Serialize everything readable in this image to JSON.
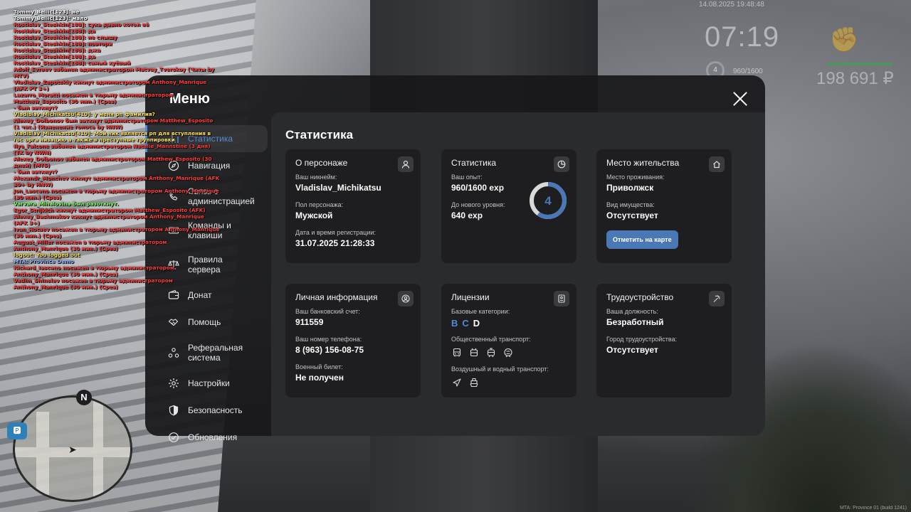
{
  "chat": [
    {
      "text": "Tommy_Bellic[123]: не",
      "color": "#ffffff"
    },
    {
      "text": "Tommy_Bellic[123]: мало",
      "color": "#ffffff"
    },
    {
      "text": "Rostislav_Steshkin[188]: сука давно хотел её",
      "color": "#ff3a3a"
    },
    {
      "text": "Rostislav_Steshkin[188]: да",
      "color": "#ff3a3a"
    },
    {
      "text": "Rostislav_Steshkin[188]: не слышу",
      "color": "#ff3a3a"
    },
    {
      "text": "Rostislav_Steshkin[188]: повтори",
      "color": "#ff3a3a"
    },
    {
      "text": "Rostislav_Steshkin[188]: джа",
      "color": "#ff3a3a"
    },
    {
      "text": "Rostislav_Steshkin[188]: да",
      "color": "#ff3a3a"
    },
    {
      "text": "Rostislav_Steshkin[188]: самый хуёвый",
      "color": "#ff3a3a"
    },
    {
      "text": "Adolf_Evreev забанен администратором Matvey_Tverskoy (Читы by MTV)",
      "color": "#ff3a3a"
    },
    {
      "text": "Vladislav_Zapotskiy кикнут администратором Anthony_Manrique (AFK PT 3+)",
      "color": "#ff3a3a"
    },
    {
      "text": "Lazarro_Moratti посажен в тюрьму администратором Matthew_Esposito (30 мин.) (Срез)",
      "color": "#ff3a3a"
    },
    {
      "text": "- был заткнут?",
      "color": "#ff3a3a"
    },
    {
      "text": "Vladislav_Michikatsu[410]: у меня рп фамилия?",
      "color": "#ffe14a"
    },
    {
      "text": "Alexey_Dolbonov был заткнут администратором Matthew_Esposito (1 час.) (Изменение голоса by HNW)",
      "color": "#ff3a3a"
    },
    {
      "text": "Vladislav_Michikatsu[410]: Мой ник является рп для вступления в гос орга низацию а также в преступные группировки",
      "color": "#ffe14a"
    },
    {
      "text": "Ilya_Falcone забанен администратором Natalie_Mannstine (3 дня) (TK by NWN)",
      "color": "#ff3a3a"
    },
    {
      "text": "Alexey_Dolbonov забанен администратором Matthew_Esposito (30 дней) (MTS)",
      "color": "#ff3a3a"
    },
    {
      "text": "- был заткнут?",
      "color": "#ff3a3a"
    },
    {
      "text": "Alexandr_Munchev кикнут администратором Anthony_Manrique (AFK 30+ by HNW)",
      "color": "#ff3a3a"
    },
    {
      "text": "Jon_Lascano посажен в тюрьму администратором Anthony_Manrique (30 мин.) (Срез)",
      "color": "#ff3a3a"
    },
    {
      "text": "Varvara_Mihalovina был разоткнут.",
      "color": "#7dff5a"
    },
    {
      "text": "Egor_Strijkich кикнут администратором Matthew_Esposito (AFK)",
      "color": "#ff3a3a"
    },
    {
      "text": "Alexey_Bashmakov кикнут администратором Anthony_Manrique (AFK 3+)",
      "color": "#ff3a3a"
    },
    {
      "text": "Ivan_Hotaev посажен в тюрьму администратором Anthony_Manrique (30 мин.) (Срез)",
      "color": "#ff3a3a"
    },
    {
      "text": "August_Miller посажен в тюрьму администратором Anthony_Manrique (30 мин.) (Срез)",
      "color": "#ff3a3a"
    },
    {
      "text": "logout: You logged out",
      "color": "#ffe14a"
    },
    {
      "text": "MTA: Province Demo",
      "color": "#8fb8ff"
    },
    {
      "text": "Richard_Iascano посажен в тюрьму администратором Anthony_Manrique (30 мин.) (Срез)",
      "color": "#ff3a3a"
    },
    {
      "text": "Vadim_Shinelev посажен в тюрьму администратором Anthony_Manrique (30 мин.) (Срез)",
      "color": "#ff3a3a"
    }
  ],
  "hud": {
    "date": "14.08.2025 19:48:48",
    "time": "07:19",
    "level": "4",
    "exp": "960/1600",
    "money": "198 691 ₽"
  },
  "minimap": {
    "north": "N"
  },
  "watermark": "MTA: Province 01 (build 1241) ",
  "menu": {
    "title": "Меню",
    "nav": [
      {
        "label": "Статистика",
        "icon": "chart-icon",
        "active": true
      },
      {
        "label": "Навигация",
        "icon": "compass-icon"
      },
      {
        "label": "Связь с администрацией",
        "icon": "phone-icon"
      },
      {
        "label": "Команды и клавиши",
        "icon": "keyboard-icon"
      },
      {
        "label": "Правила сервера",
        "icon": "scales-icon"
      },
      {
        "label": "Донат",
        "icon": "wallet-icon"
      },
      {
        "label": "Помощь",
        "icon": "handshake-icon"
      },
      {
        "label": "Реферальная система",
        "icon": "referral-icon"
      },
      {
        "label": "Настройки",
        "icon": "gear-icon"
      },
      {
        "label": "Безопасность",
        "icon": "shield-icon"
      },
      {
        "label": "Обновления",
        "icon": "update-icon"
      }
    ]
  },
  "stats": {
    "title": "Статистика",
    "character": {
      "title": "О персонаже",
      "nickname_label": "Ваш никнейм:",
      "nickname": "Vladislav_Michikatsu",
      "gender_label": "Пол персонажа:",
      "gender": "Мужской",
      "reg_label": "Дата и время регистрации:",
      "reg": "31.07.2025 21:28:33"
    },
    "statistics": {
      "title": "Статистика",
      "exp_label": "Ваш опыт:",
      "exp": "960/1600 exp",
      "next_label": "До нового уровня:",
      "next": "640 exp",
      "level": "4",
      "progress": 0.6
    },
    "residence": {
      "title": "Место жительства",
      "place_label": "Место проживания:",
      "place": "Приволжск",
      "property_label": "Вид имущества:",
      "property": "Отсутствует",
      "button": "Отметить на карте"
    },
    "personal": {
      "title": "Личная информация",
      "bank_label": "Ваш банковский счет:",
      "bank": "911559",
      "phone_label": "Ваш номер телефона:",
      "phone": "8 (963) 156-08-75",
      "military_label": "Военный билет:",
      "military": "Не получен"
    },
    "licenses": {
      "title": "Лицензии",
      "basic_label": "Базовые категории:",
      "categories": [
        {
          "letter": "B",
          "color": "#4f8bd6"
        },
        {
          "letter": "C",
          "color": "#4f8bd6"
        },
        {
          "letter": "D",
          "color": "#ffffff"
        }
      ],
      "public_label": "Общественный транспорт:",
      "air_label": "Воздушный и водный транспорт:"
    },
    "employment": {
      "title": "Трудоустройство",
      "position_label": "Ваша должность:",
      "position": "Безработный",
      "city_label": "Город трудоустройства:",
      "city": "Отсутствует"
    }
  },
  "colors": {
    "accent": "#4f8bd6",
    "panel": "#2a2b2d",
    "card": "#1e1e20"
  }
}
